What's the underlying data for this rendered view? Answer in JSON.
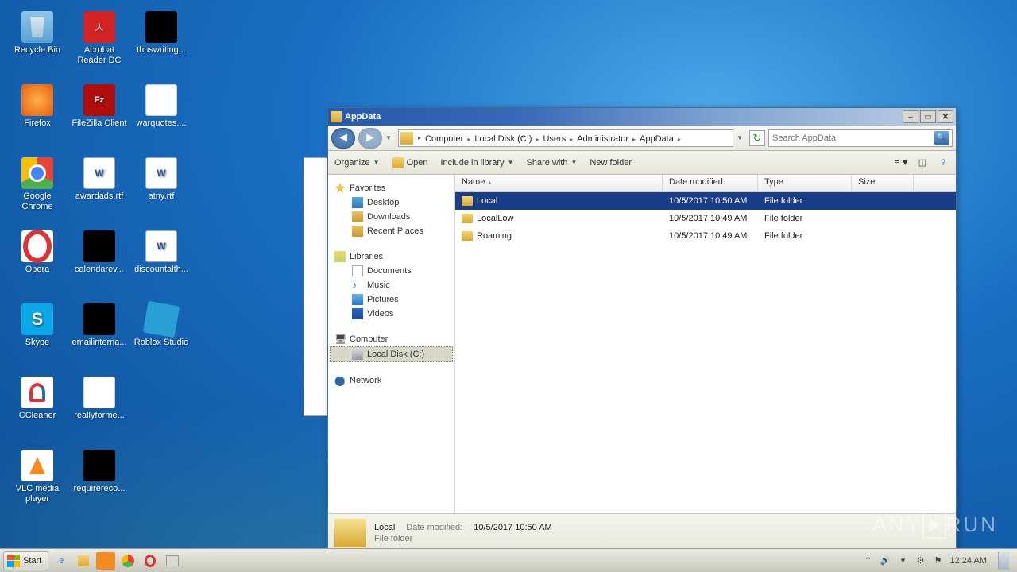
{
  "desktop_icons": [
    [
      "Recycle Bin",
      "i-recycle"
    ],
    [
      "Acrobat Reader DC",
      "i-acrobat"
    ],
    [
      "thuswriting...",
      "i-black"
    ],
    [
      "Firefox",
      "i-firefox"
    ],
    [
      "FileZilla Client",
      "i-filezilla"
    ],
    [
      "warquotes....",
      "i-blank"
    ],
    [
      "Google Chrome",
      "i-chrome"
    ],
    [
      "awardads.rtf",
      "i-word"
    ],
    [
      "atny.rtf",
      "i-word"
    ],
    [
      "Opera",
      "i-opera"
    ],
    [
      "calendarev...",
      "i-black"
    ],
    [
      "discountalth...",
      "i-word"
    ],
    [
      "Skype",
      "i-skype"
    ],
    [
      "emailinterna...",
      "i-black"
    ],
    [
      "Roblox Studio",
      "i-roblox"
    ],
    [
      "CCleaner",
      "i-ccleaner"
    ],
    [
      "reallyforme...",
      "i-blank"
    ],
    null,
    [
      "VLC media player",
      "i-vlc"
    ],
    [
      "requirereco...",
      "i-black"
    ],
    null
  ],
  "window": {
    "title": "AppData",
    "breadcrumb": [
      "Computer",
      "Local Disk (C:)",
      "Users",
      "Administrator",
      "AppData"
    ],
    "search_placeholder": "Search AppData",
    "toolbar": {
      "organize": "Organize",
      "open": "Open",
      "include": "Include in library",
      "share": "Share with",
      "newfolder": "New folder"
    },
    "nav": {
      "favorites": {
        "label": "Favorites",
        "items": [
          "Desktop",
          "Downloads",
          "Recent Places"
        ]
      },
      "libraries": {
        "label": "Libraries",
        "items": [
          "Documents",
          "Music",
          "Pictures",
          "Videos"
        ]
      },
      "computer": {
        "label": "Computer",
        "items": [
          "Local Disk (C:)"
        ]
      },
      "network": {
        "label": "Network"
      }
    },
    "columns": {
      "name": "Name",
      "date": "Date modified",
      "type": "Type",
      "size": "Size"
    },
    "rows": [
      {
        "name": "Local",
        "date": "10/5/2017 10:50 AM",
        "type": "File folder",
        "selected": true
      },
      {
        "name": "LocalLow",
        "date": "10/5/2017 10:49 AM",
        "type": "File folder",
        "selected": false
      },
      {
        "name": "Roaming",
        "date": "10/5/2017 10:49 AM",
        "type": "File folder",
        "selected": false
      }
    ],
    "details": {
      "name": "Local",
      "date_label": "Date modified:",
      "date": "10/5/2017 10:50 AM",
      "type": "File folder"
    }
  },
  "taskbar": {
    "start": "Start",
    "time": "12:24 AM"
  },
  "watermark": {
    "a": "ANY",
    "b": "RUN"
  }
}
